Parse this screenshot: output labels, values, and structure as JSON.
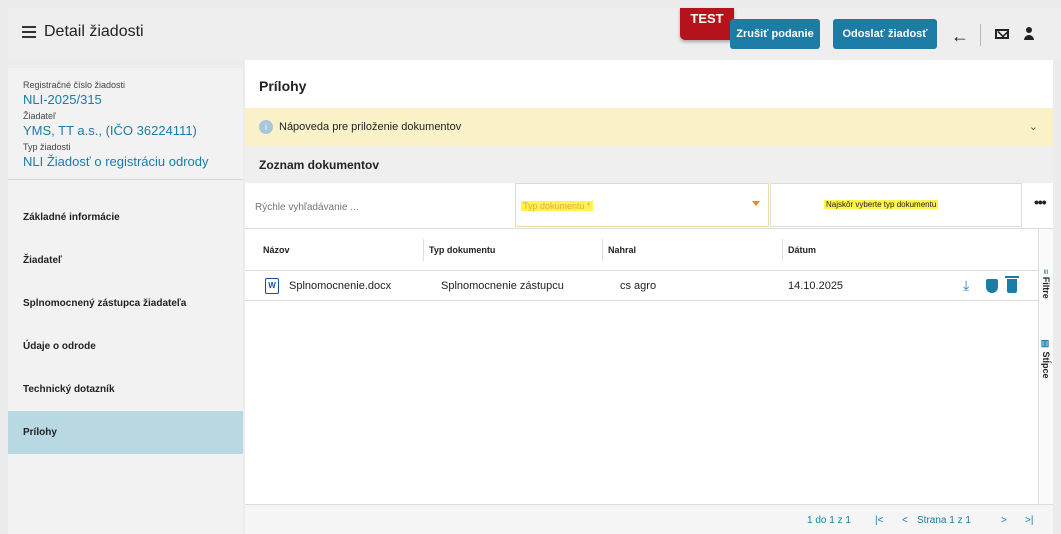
{
  "header": {
    "title": "Detail žiadosti",
    "test_badge": "TEST",
    "cancel_label": "Zrušiť podanie",
    "send_label": "Odoslať žiadosť",
    "back_icon": "arrow-left-icon",
    "mail_icon": "mail-icon",
    "user_icon": "user-icon"
  },
  "sidebar": {
    "reg_label": "Registračné číslo žiadosti",
    "reg_value": "NLI-2025/315",
    "applicant_label": "Žiadateľ",
    "applicant_value": "YMS, TT a.s., (IČO 36224111)",
    "type_label": "Typ žiadosti",
    "type_value": "NLI Žiadosť o registráciu odrody",
    "items": [
      {
        "label": "Základné informácie"
      },
      {
        "label": "Žiadateľ"
      },
      {
        "label": "Splnomocnený zástupca žiadateľa"
      },
      {
        "label": "Údaje o odrode"
      },
      {
        "label": "Technický dotazník"
      },
      {
        "label": "Prílohy"
      }
    ]
  },
  "main": {
    "title": "Prílohy",
    "help_text": "Nápoveda pre priloženie dokumentov",
    "list_title": "Zoznam dokumentov",
    "search_placeholder": "Rýchle vyhľadávanie ...",
    "doc_type_placeholder": "Typ dokumentu *",
    "upload_hint": "Najskôr vyberte typ dokumentu",
    "more": "•••",
    "columns": [
      "Názov",
      "Typ dokumentu",
      "Nahral",
      "Dátum"
    ],
    "rows": [
      {
        "name": "Splnomocnenie.docx",
        "type": "Splnomocnenie zástupcu",
        "uploader": "cs agro",
        "date": "14.10.2025"
      }
    ],
    "side_tools": {
      "filters": "Filtre",
      "columns": "Stĺpce"
    },
    "pager": {
      "range": "1 do 1 z 1",
      "first": "|<",
      "prev": "<",
      "page_text": "Strana 1 z 1",
      "next": ">",
      "last": ">|"
    }
  },
  "colors": {
    "accent": "#1c7ca5",
    "test_badge": "#b5121b",
    "help_bg": "#faf1c9",
    "active_nav": "#b8d8e2",
    "highlight": "#fff44a"
  }
}
